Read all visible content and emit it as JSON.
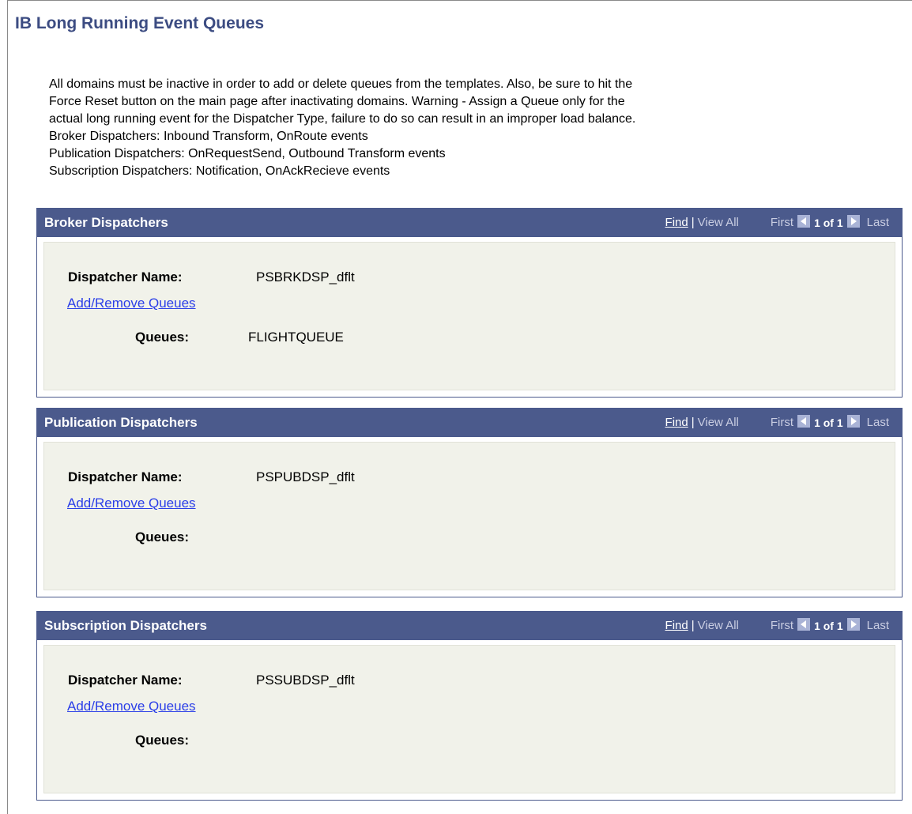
{
  "page": {
    "title": "IB Long Running Event Queues"
  },
  "instructions": [
    "All domains must be inactive in order to add or delete queues from the templates.  Also, be sure to hit the",
    "Force Reset button on the main page after inactivating domains. Warning - Assign a Queue only for the",
    "actual long running event for the Dispatcher Type, failure to do so can result in an improper load balance.",
    "Broker Dispatchers:  Inbound Transform, OnRoute events",
    "Publication Dispatchers: OnRequestSend, Outbound Transform events",
    "Subscription Dispatchers: Notification, OnAckRecieve events"
  ],
  "nav": {
    "find": "Find",
    "separator": "|",
    "view_all": "View All",
    "first": "First",
    "count": "1 of 1",
    "last": "Last"
  },
  "labels": {
    "dispatcher_name": "Dispatcher Name:",
    "add_remove_queues": "Add/Remove Queues",
    "queues": "Queues:"
  },
  "panels": [
    {
      "title": "Broker Dispatchers",
      "dispatcher_name": "PSBRKDSP_dflt",
      "queues": "FLIGHTQUEUE"
    },
    {
      "title": "Publication Dispatchers",
      "dispatcher_name": "PSPUBDSP_dflt",
      "queues": ""
    },
    {
      "title": "Subscription Dispatchers",
      "dispatcher_name": "PSSUBDSP_dflt",
      "queues": ""
    }
  ],
  "colors": {
    "header_bar": "#4b5a8c",
    "title_text": "#3c4c82",
    "link": "#2a3ee8",
    "panel_body": "#f1f2ea"
  }
}
